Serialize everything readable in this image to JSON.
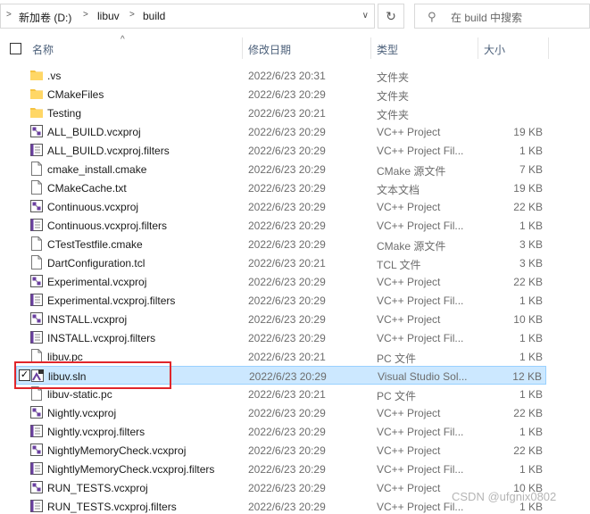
{
  "address_bar": {
    "crumbs": [
      "新加卷 (D:)",
      "libuv",
      "build"
    ],
    "refresh_icon": "refresh-icon",
    "search_placeholder": "在 build 中搜索"
  },
  "columns": {
    "name": "名称",
    "date": "修改日期",
    "type": "类型",
    "size": "大小"
  },
  "colors": {
    "selected_bg": "#cce8ff",
    "highlight_box": "#e0262b",
    "folder": "#f5c342"
  },
  "files": [
    {
      "name": ".vs",
      "date": "2022/6/23 20:31",
      "type": "文件夹",
      "size": "",
      "icon": "folder-icon"
    },
    {
      "name": "CMakeFiles",
      "date": "2022/6/23 20:29",
      "type": "文件夹",
      "size": "",
      "icon": "folder-icon"
    },
    {
      "name": "Testing",
      "date": "2022/6/23 20:21",
      "type": "文件夹",
      "size": "",
      "icon": "folder-icon"
    },
    {
      "name": "ALL_BUILD.vcxproj",
      "date": "2022/6/23 20:29",
      "type": "VC++ Project",
      "size": "19 KB",
      "icon": "vcxproj-icon"
    },
    {
      "name": "ALL_BUILD.vcxproj.filters",
      "date": "2022/6/23 20:29",
      "type": "VC++ Project Fil...",
      "size": "1 KB",
      "icon": "filters-icon"
    },
    {
      "name": "cmake_install.cmake",
      "date": "2022/6/23 20:29",
      "type": "CMake 源文件",
      "size": "7 KB",
      "icon": "file-icon"
    },
    {
      "name": "CMakeCache.txt",
      "date": "2022/6/23 20:29",
      "type": "文本文档",
      "size": "19 KB",
      "icon": "file-icon"
    },
    {
      "name": "Continuous.vcxproj",
      "date": "2022/6/23 20:29",
      "type": "VC++ Project",
      "size": "22 KB",
      "icon": "vcxproj-icon"
    },
    {
      "name": "Continuous.vcxproj.filters",
      "date": "2022/6/23 20:29",
      "type": "VC++ Project Fil...",
      "size": "1 KB",
      "icon": "filters-icon"
    },
    {
      "name": "CTestTestfile.cmake",
      "date": "2022/6/23 20:29",
      "type": "CMake 源文件",
      "size": "3 KB",
      "icon": "file-icon"
    },
    {
      "name": "DartConfiguration.tcl",
      "date": "2022/6/23 20:21",
      "type": "TCL 文件",
      "size": "3 KB",
      "icon": "file-icon"
    },
    {
      "name": "Experimental.vcxproj",
      "date": "2022/6/23 20:29",
      "type": "VC++ Project",
      "size": "22 KB",
      "icon": "vcxproj-icon"
    },
    {
      "name": "Experimental.vcxproj.filters",
      "date": "2022/6/23 20:29",
      "type": "VC++ Project Fil...",
      "size": "1 KB",
      "icon": "filters-icon"
    },
    {
      "name": "INSTALL.vcxproj",
      "date": "2022/6/23 20:29",
      "type": "VC++ Project",
      "size": "10 KB",
      "icon": "vcxproj-icon"
    },
    {
      "name": "INSTALL.vcxproj.filters",
      "date": "2022/6/23 20:29",
      "type": "VC++ Project Fil...",
      "size": "1 KB",
      "icon": "filters-icon"
    },
    {
      "name": "libuv.pc",
      "date": "2022/6/23 20:21",
      "type": "PC 文件",
      "size": "1 KB",
      "icon": "file-icon"
    },
    {
      "name": "libuv.sln",
      "date": "2022/6/23 20:29",
      "type": "Visual Studio Sol...",
      "size": "12 KB",
      "icon": "sln-icon",
      "selected": true
    },
    {
      "name": "libuv-static.pc",
      "date": "2022/6/23 20:21",
      "type": "PC 文件",
      "size": "1 KB",
      "icon": "file-icon"
    },
    {
      "name": "Nightly.vcxproj",
      "date": "2022/6/23 20:29",
      "type": "VC++ Project",
      "size": "22 KB",
      "icon": "vcxproj-icon"
    },
    {
      "name": "Nightly.vcxproj.filters",
      "date": "2022/6/23 20:29",
      "type": "VC++ Project Fil...",
      "size": "1 KB",
      "icon": "filters-icon"
    },
    {
      "name": "NightlyMemoryCheck.vcxproj",
      "date": "2022/6/23 20:29",
      "type": "VC++ Project",
      "size": "22 KB",
      "icon": "vcxproj-icon"
    },
    {
      "name": "NightlyMemoryCheck.vcxproj.filters",
      "date": "2022/6/23 20:29",
      "type": "VC++ Project Fil...",
      "size": "1 KB",
      "icon": "filters-icon"
    },
    {
      "name": "RUN_TESTS.vcxproj",
      "date": "2022/6/23 20:29",
      "type": "VC++ Project",
      "size": "10 KB",
      "icon": "vcxproj-icon"
    },
    {
      "name": "RUN_TESTS.vcxproj.filters",
      "date": "2022/6/23 20:29",
      "type": "VC++ Project Fil...",
      "size": "1 KB",
      "icon": "filters-icon"
    }
  ],
  "watermark": "CSDN @ufgnix0802"
}
